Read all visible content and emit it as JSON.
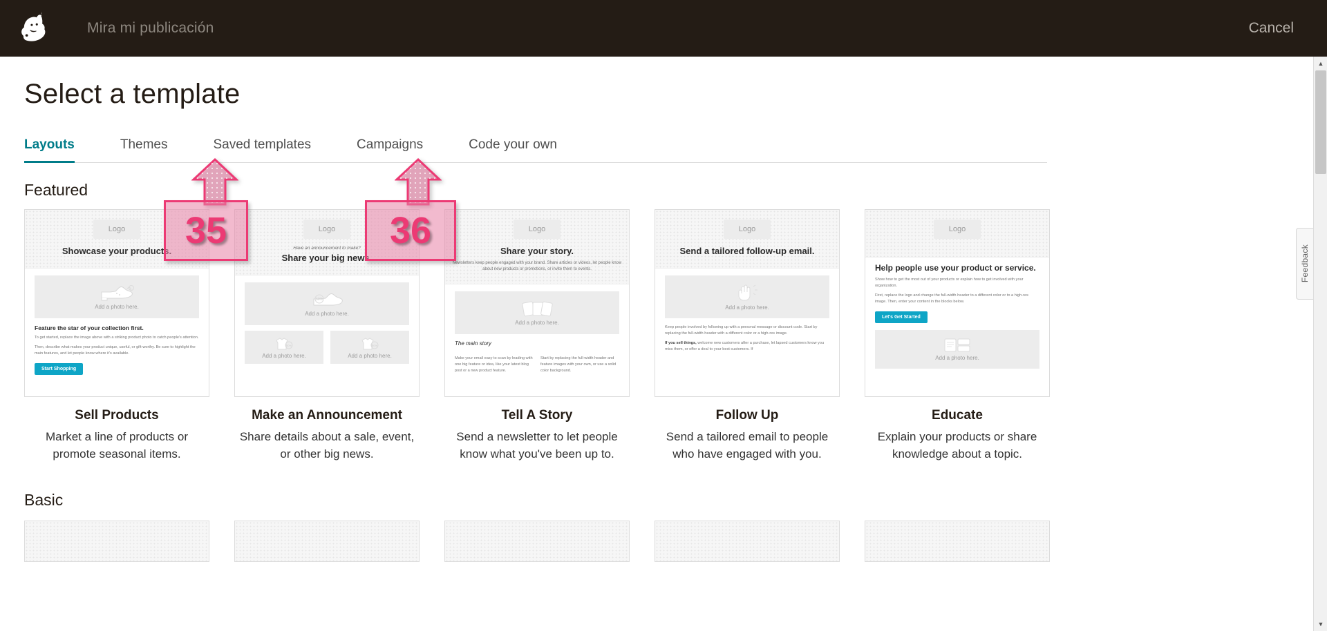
{
  "topbar": {
    "logo_icon": "mailchimp-freddie-logo",
    "title": "Mira mi publicación",
    "cancel_label": "Cancel"
  },
  "feedback": {
    "label": "Feedback"
  },
  "page": {
    "title": "Select a template",
    "featured_heading": "Featured",
    "basic_heading": "Basic"
  },
  "tabs": [
    {
      "label": "Layouts",
      "active": true
    },
    {
      "label": "Themes",
      "active": false
    },
    {
      "label": "Saved templates",
      "active": false
    },
    {
      "label": "Campaigns",
      "active": false
    },
    {
      "label": "Code your own",
      "active": false
    }
  ],
  "annotations": [
    {
      "number": "35",
      "target": "Saved templates tab"
    },
    {
      "number": "36",
      "target": "Code your own tab"
    }
  ],
  "colors": {
    "topbar_bg": "#241c15",
    "accent_teal": "#007c89",
    "annotation_pink": "#ec3a74",
    "cta_blue": "#0ea5c6"
  },
  "featured": [
    {
      "title": "Sell Products",
      "desc": "Market a line of products or promote seasonal items.",
      "logo_label": "Logo",
      "headline": "Showcase your products.",
      "photo_caption": "Add a photo here.",
      "photo_icon": "shoe-icon",
      "body_heading": "Feature the star of your collection first.",
      "body_p1": "To get started, replace the image above with a striking product photo to catch people's attention.",
      "body_p2": "Then, describe what makes your product unique, useful, or gift-worthy. Be sure to highlight the main features, and let people know where it's available.",
      "cta": "Start Shopping"
    },
    {
      "title": "Make an Announcement",
      "desc": "Share details about a sale, event, or other big news.",
      "logo_label": "Logo",
      "eyebrow": "Have an announcement to make?",
      "headline": "Share your big news.",
      "photo_caption": "Add a photo here.",
      "photo_icon": "shoe-tag-icon",
      "photo_caption_left": "Add a photo here.",
      "photo_caption_right": "Add a photo here.",
      "sub_icon_left": "shirt-tag-icon",
      "sub_icon_right": "shirt-tag-icon"
    },
    {
      "title": "Tell A Story",
      "desc": "Send a newsletter to let people know what you've been up to.",
      "logo_label": "Logo",
      "headline": "Share your story.",
      "intro": "Newsletters keep people engaged with your brand. Share articles or videos, let people know about new products or promotions, or invite them to events.",
      "photo_caption": "Add a photo here.",
      "photo_icon": "cards-icon",
      "body_heading": "The main story",
      "body_left": "Make your email easy to scan by leading with one big feature or idea, like your latest blog post or a new product feature.",
      "body_right": "Start by replacing the full-width header and feature images with your own, or use a solid color background.",
      "body_right_link": "solid color background"
    },
    {
      "title": "Follow Up",
      "desc": "Send a tailored email to people who have engaged with you.",
      "logo_label": "Logo",
      "headline": "Send a tailored follow-up email.",
      "photo_caption": "Add a photo here.",
      "photo_icon": "hand-wave-icon",
      "body_p1": "Keep people involved by following up with a personal message or discount code. Start by replacing the full-width header with a different color or a high-res image.",
      "body_p2_bold": "If you sell things,",
      "body_p2": " welcome new customers after a purchase, let lapsed customers know you miss them, or offer a deal to your best customers. If"
    },
    {
      "title": "Educate",
      "desc": "Explain your products or share knowledge about a topic.",
      "logo_label": "Logo",
      "headline": "Help people use your product or service.",
      "intro": "Show how to get the most out of your products or explain how to get involved with your organization.",
      "intro2": "First, replace the logo and change the full-width header to a different color or to a high-res image. Then, enter your content in the blocks below.",
      "cta": "Let's Get Started",
      "photo_caption": "Add a photo here.",
      "photo_icon": "layout-grid-icon"
    }
  ]
}
